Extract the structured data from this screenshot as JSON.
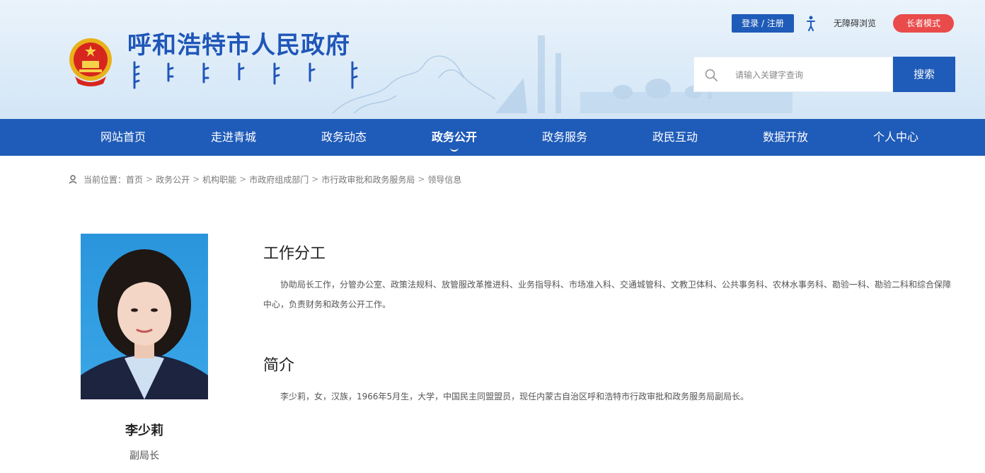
{
  "header": {
    "site_title": "呼和浩特市人民政府",
    "login_label": "登录 / 注册",
    "accessibility_label": "无障碍浏览",
    "elder_mode_label": "长者模式",
    "search_placeholder": "请输入关键字查询",
    "search_button_label": "搜索",
    "colors": {
      "primary": "#1f5bb8",
      "elder": "#e94b4b"
    }
  },
  "nav": {
    "items": [
      {
        "label": "网站首页"
      },
      {
        "label": "走进青城"
      },
      {
        "label": "政务动态"
      },
      {
        "label": "政务公开"
      },
      {
        "label": "政务服务"
      },
      {
        "label": "政民互动"
      },
      {
        "label": "数据开放"
      },
      {
        "label": "个人中心"
      }
    ],
    "active_label": "政务公开"
  },
  "breadcrumb": {
    "prefix": "当前位置：",
    "items": [
      "首页",
      "政务公开",
      "机构职能",
      "市政府组成部门",
      "市行政审批和政务服务局",
      "领导信息"
    ],
    "separator": ">"
  },
  "profile": {
    "name": "李少莉",
    "title": "副局长"
  },
  "sections": {
    "duties": {
      "heading": "工作分工",
      "body": "协助局长工作，分管办公室、政策法规科、放管服改革推进科、业务指导科、市场准入科、交通城管科、文教卫体科、公共事务科、农林水事务科、勘验一科、勘验二科和综合保障中心，负责财务和政务公开工作。"
    },
    "bio": {
      "heading": "简介",
      "body": "李少莉，女，汉族，1966年5月生，大学，中国民主同盟盟员，现任内蒙古自治区呼和浩特市行政审批和政务服务局副局长。"
    }
  }
}
